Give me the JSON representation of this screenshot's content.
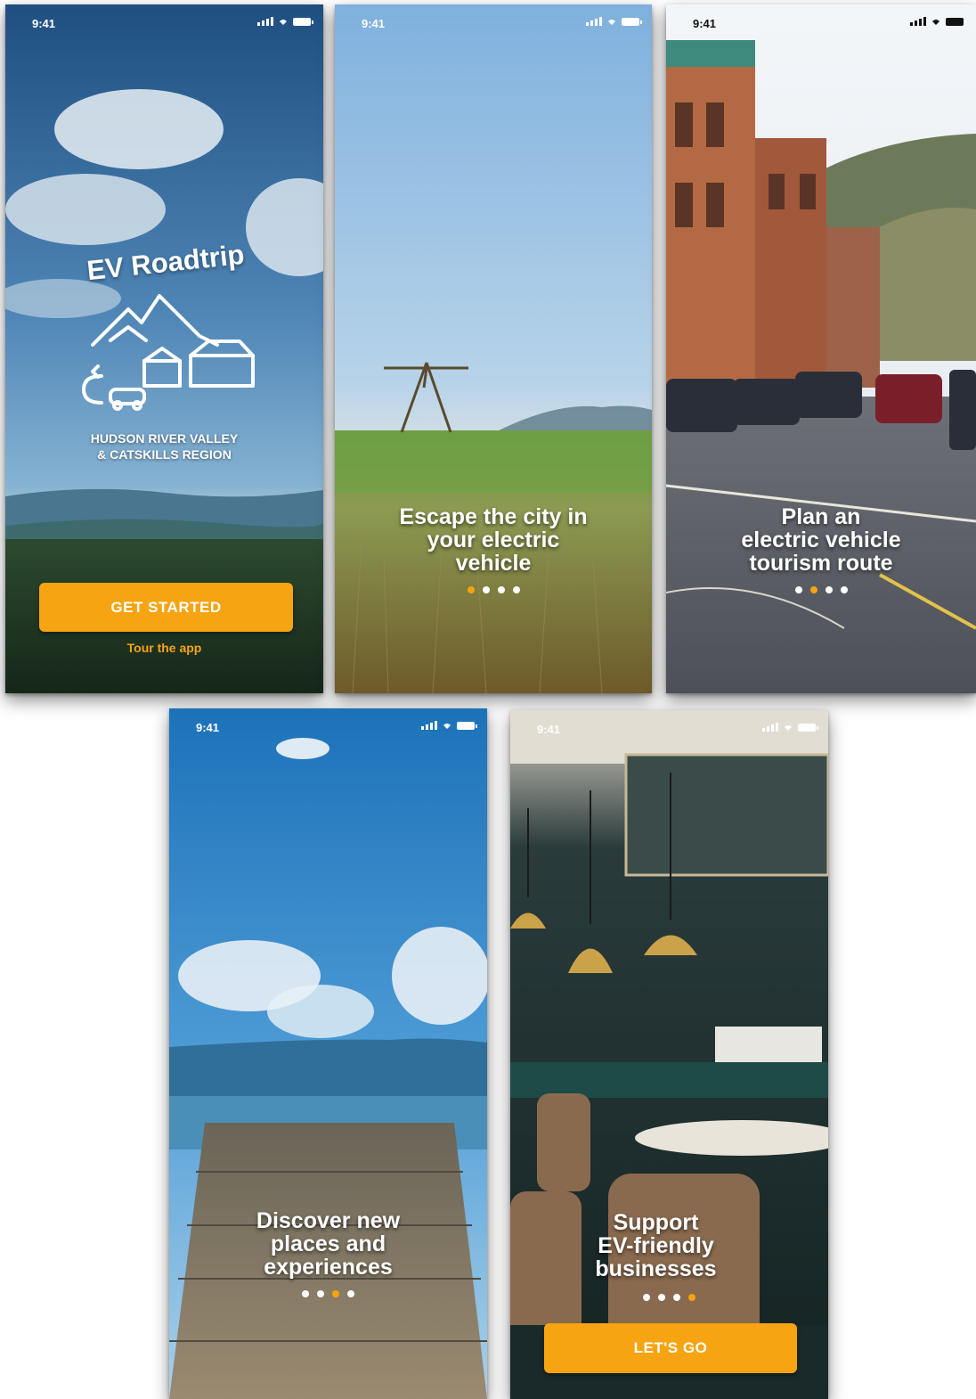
{
  "status_bar": {
    "time": "9:41"
  },
  "screens": [
    {
      "app_title": "EV Roadtrip",
      "region_line1": "HUDSON RIVER VALLEY",
      "region_line2": "& CATSKILLS REGION",
      "primary_button": "GET STARTED",
      "secondary_link": "Tour the app"
    },
    {
      "headline_lines": [
        "Escape the city in",
        "your electric",
        "vehicle"
      ],
      "active_dot": 1
    },
    {
      "headline_lines": [
        "Plan an",
        "electric vehicle",
        "tourism route"
      ],
      "active_dot": 2
    },
    {
      "headline_lines": [
        "Discover new",
        "places and",
        "experiences"
      ],
      "active_dot": 3
    },
    {
      "headline_lines": [
        "Support",
        "EV-friendly",
        "businesses"
      ],
      "active_dot": 4,
      "primary_button": "LET'S GO"
    }
  ],
  "colors": {
    "accent": "#f6a412",
    "text": "#ffffff"
  }
}
